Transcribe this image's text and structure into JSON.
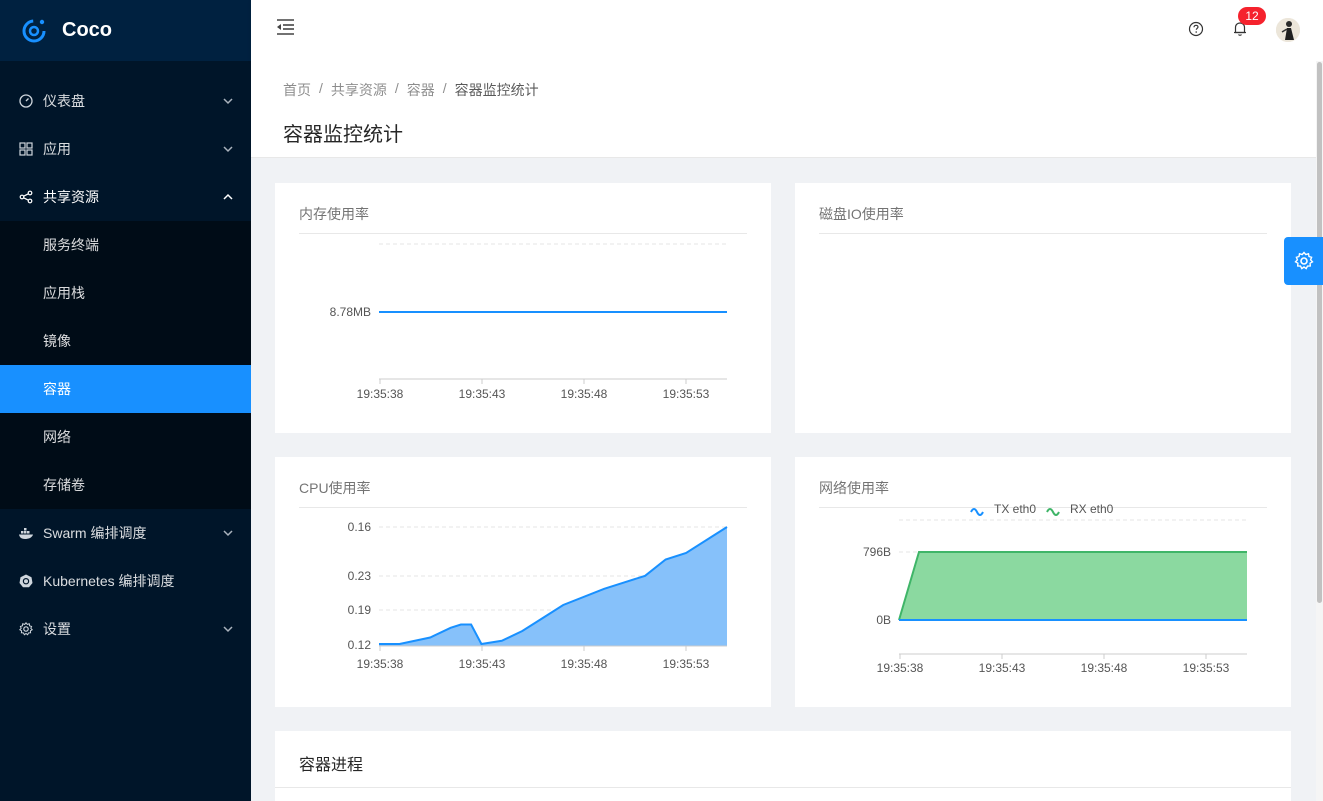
{
  "app": {
    "name": "Coco"
  },
  "sidebar": {
    "items": [
      {
        "label": "仪表盘",
        "icon": "dashboard-icon"
      },
      {
        "label": "应用",
        "icon": "appstore-icon"
      },
      {
        "label": "共享资源",
        "icon": "share-icon"
      },
      {
        "label": "Swarm 编排调度",
        "icon": "docker-icon"
      },
      {
        "label": "Kubernetes 编排调度",
        "icon": "kubernetes-icon"
      },
      {
        "label": "设置",
        "icon": "setting-icon"
      }
    ],
    "submenu": [
      {
        "label": "服务终端"
      },
      {
        "label": "应用栈"
      },
      {
        "label": "镜像"
      },
      {
        "label": "容器",
        "active": true
      },
      {
        "label": "网络"
      },
      {
        "label": "存储卷"
      }
    ]
  },
  "header": {
    "notification_count": "12"
  },
  "breadcrumb": [
    "首页",
    "共享资源",
    "容器",
    "容器监控统计"
  ],
  "page_title": "容器监控统计",
  "cards": {
    "memory": {
      "title": "内存使用率"
    },
    "disk": {
      "title": "磁盘IO使用率"
    },
    "cpu": {
      "title": "CPU使用率"
    },
    "network": {
      "title": "网络使用率"
    }
  },
  "process_card": {
    "title": "容器进程"
  },
  "colors": {
    "sidebar": "#001529",
    "accent": "#1890ff",
    "area_blue": "#86c1fa",
    "area_green": "#8bd9a0",
    "line_green": "#3fb568",
    "badge": "#f5222d"
  },
  "chart_data": [
    {
      "type": "line",
      "title": "内存使用率",
      "x": [
        "19:35:38",
        "19:35:43",
        "19:35:48",
        "19:35:53"
      ],
      "y_tick_labels": [
        "8.78MB"
      ],
      "series": [
        {
          "values": [
            "8.78MB",
            "8.78MB",
            "8.78MB",
            "8.78MB"
          ]
        }
      ],
      "grid": true
    },
    {
      "type": "line",
      "title": "磁盘IO使用率",
      "series": []
    },
    {
      "type": "area",
      "title": "CPU使用率",
      "x": [
        "19:35:38",
        "19:35:43",
        "19:35:48",
        "19:35:53"
      ],
      "y_tick_labels": [
        "0.16",
        "0.23",
        "0.19",
        "0.12"
      ],
      "series": [
        {
          "x_seconds": [
            0,
            1,
            2.5,
            3.5,
            4,
            4.5,
            5,
            6,
            7,
            8,
            9,
            11,
            12,
            13,
            14,
            15,
            17
          ],
          "values": [
            0.12,
            0.12,
            0.13,
            0.145,
            0.15,
            0.15,
            0.12,
            0.125,
            0.14,
            0.16,
            0.18,
            0.205,
            0.215,
            0.225,
            0.25,
            0.26,
            0.3
          ]
        }
      ],
      "grid": true
    },
    {
      "type": "area",
      "title": "网络使用率",
      "x": [
        "19:35:38",
        "19:35:43",
        "19:35:48",
        "19:35:53"
      ],
      "y_tick_labels": [
        "796B",
        "0B"
      ],
      "legend": [
        "TX eth0",
        "RX eth0"
      ],
      "legend_position": "top",
      "series": [
        {
          "name": "TX eth0",
          "values": [
            0,
            0,
            0,
            0
          ]
        },
        {
          "name": "RX eth0",
          "values": [
            0,
            796,
            796,
            796
          ]
        }
      ],
      "grid": true
    }
  ]
}
